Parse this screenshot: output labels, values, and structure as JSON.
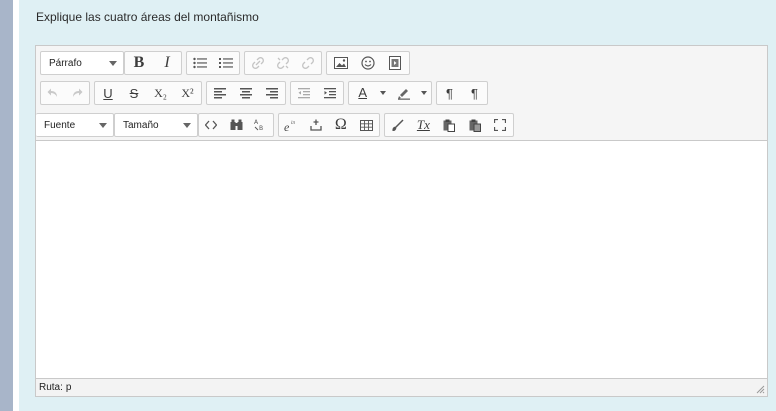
{
  "question": {
    "text": "Explique las cuatro áreas del montañismo"
  },
  "toolbar": {
    "paragraph_select": "Párrafo",
    "font_select": "Fuente",
    "size_select": "Tamaño",
    "bold": "B",
    "italic": "I",
    "underline": "U",
    "strikethrough": "S",
    "subscript": "X₂",
    "superscript": "X²",
    "font_color": "A",
    "pilcrow_ltr": "¶",
    "pilcrow_rtl": "¶",
    "omega": "Ω",
    "clear_format": "Tx"
  },
  "status": {
    "path_label": "Ruta:",
    "path_value": "p"
  }
}
